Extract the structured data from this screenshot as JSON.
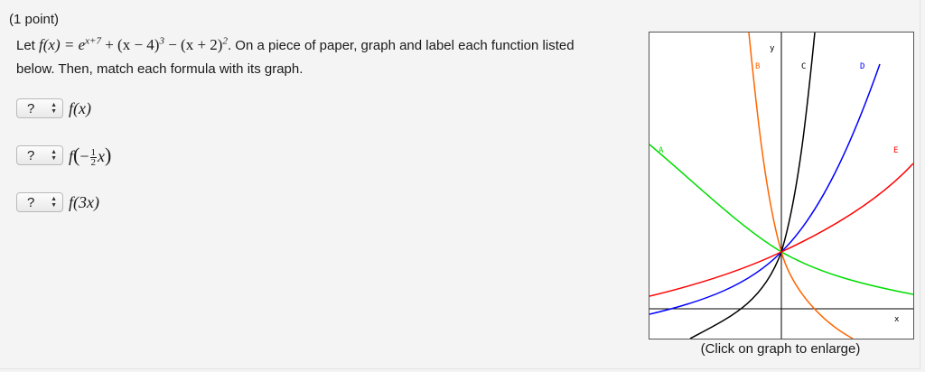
{
  "problem": {
    "points": "(1 point)",
    "intro": "Let",
    "fdef_lhs": "f(x) = e",
    "fdef_exp": "x+7",
    "fdef_mid": " + (x − 4)",
    "fdef_exp2": "3",
    "fdef_mid2": " − (x + 2)",
    "fdef_exp3": "2",
    "text_after": ". On a piece of paper, graph and label each function listed below. Then, match each formula with its graph."
  },
  "rows": [
    {
      "select_value": "?",
      "formula": "f(x)"
    },
    {
      "select_value": "?",
      "formula_prefix": "f",
      "frac_num": "1",
      "frac_den": "2",
      "formula_x": "x"
    },
    {
      "select_value": "?",
      "formula": "f(3x)"
    }
  ],
  "graph": {
    "caption": "(Click on graph to enlarge)",
    "axis_x_label": "x",
    "axis_y_label": "y",
    "curve_labels": {
      "A": "A",
      "B": "B",
      "C": "C",
      "D": "D",
      "E": "E"
    },
    "colors": {
      "A": "#00dd00",
      "B": "#ff6600",
      "C": "#000000",
      "D": "#0000ff",
      "E": "#ff0000"
    }
  }
}
